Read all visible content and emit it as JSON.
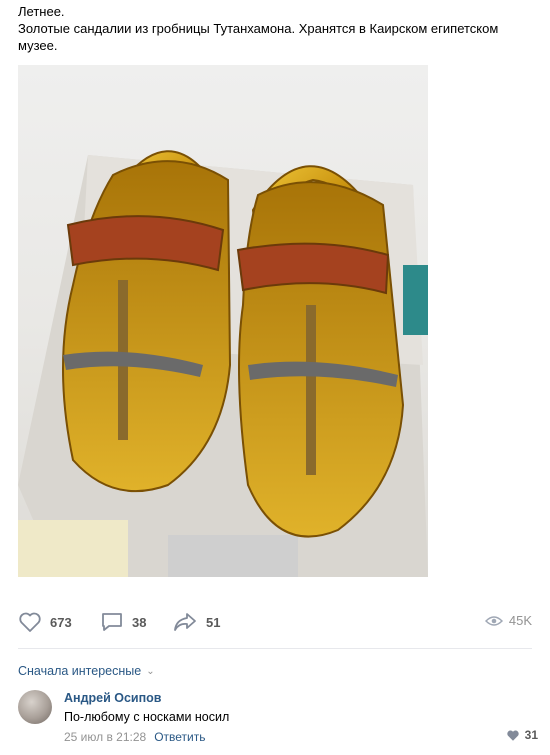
{
  "post": {
    "line1": "Летнее.",
    "line2": "Золотые сандалии из гробницы Тутанхамона. Хранятся в Каирском египетском музее."
  },
  "actions": {
    "likes": "673",
    "comments": "38",
    "shares": "51",
    "views": "45K"
  },
  "comments_section": {
    "sort_label": "Сначала интересные",
    "comment": {
      "author": "Андрей Осипов",
      "text": "По-любому с носками носил",
      "date": "25 июл в 21:28",
      "reply_label": "Ответить",
      "likes": "31"
    }
  },
  "colors": {
    "link": "#2a5885",
    "muted": "#939393",
    "gold": "#d4a21a"
  },
  "icons": [
    "heart-icon",
    "comment-icon",
    "share-icon",
    "eye-icon",
    "chevron-down-icon"
  ]
}
